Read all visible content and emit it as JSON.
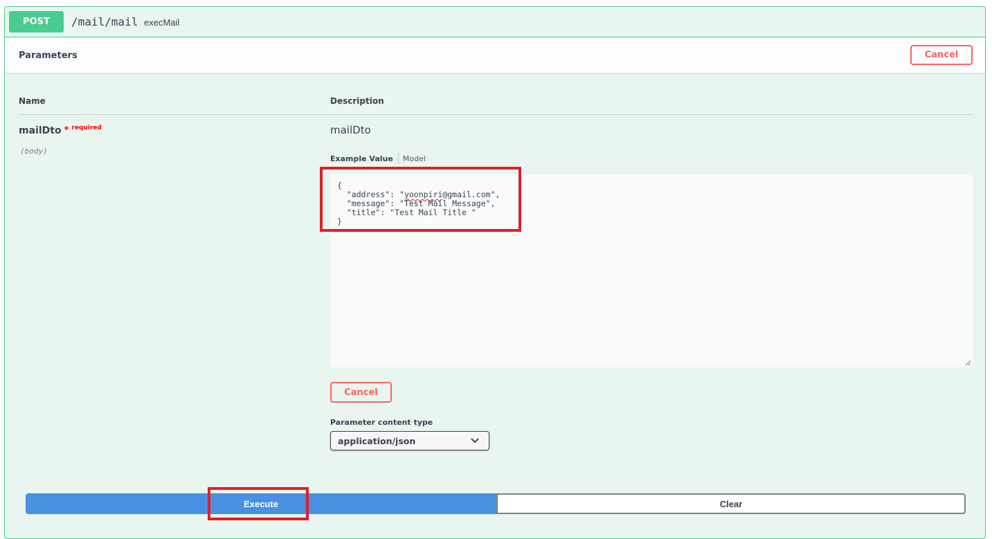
{
  "operation": {
    "method": "POST",
    "path": "/mail/mail",
    "operation_id": "execMail"
  },
  "parameters_section": {
    "title": "Parameters",
    "cancel_label": "Cancel",
    "columns": {
      "name": "Name",
      "description": "Description"
    }
  },
  "param": {
    "name": "mailDto",
    "required_star": "*",
    "required_label": "required",
    "in": "(body)",
    "description": "mailDto"
  },
  "body_tabs": {
    "example_value": "Example Value",
    "model": "Model"
  },
  "body_editor": {
    "line_open": "{",
    "address_key": "  \"address\": \"",
    "address_user": "yoonpiri",
    "address_rest": "@gmail.com\",",
    "message_line": "  \"message\": \"Test Mail Message\",",
    "title_line": "  \"title\": \"Test Mail Title \"",
    "line_close": "}"
  },
  "body_cancel_label": "Cancel",
  "content_type": {
    "label": "Parameter content type",
    "selected": "application/json"
  },
  "actions": {
    "execute_label": "Execute",
    "clear_label": "Clear"
  },
  "colors": {
    "post_green": "#49cc90",
    "execute_blue": "#4990e2",
    "cancel_red": "#ff6060",
    "highlight_red": "#e01e27"
  },
  "icons": {
    "select_arrow": "chevron-down-icon",
    "resize_handle": "resize-grip-icon"
  }
}
